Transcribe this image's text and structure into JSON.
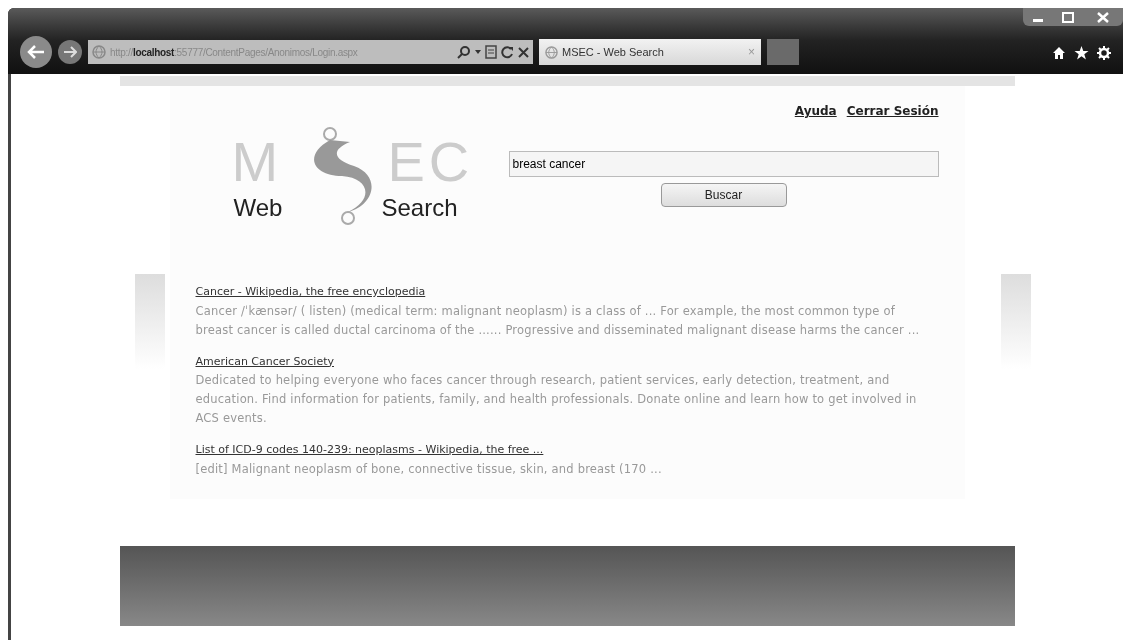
{
  "browser": {
    "address": "http://**localhost**:55777/ContentPages/Anonimos/Login.aspx",
    "tab_title": "MSEC - Web Search",
    "tab_close": "×",
    "window_buttons": [
      {
        "kind": "minimize"
      },
      {
        "kind": "maximize"
      },
      {
        "kind": "close"
      }
    ]
  },
  "header_links": [
    {
      "label": "Ayuda"
    },
    {
      "label": "Cerrar Sesión"
    }
  ],
  "logo": {
    "letters_left": "M",
    "letters_right": "EC",
    "word_left": "Web",
    "word_right": "Search"
  },
  "search": {
    "value": "breast cancer",
    "button": "Buscar"
  },
  "results": [
    {
      "title": "Cancer - Wikipedia, the free encyclopedia",
      "snippet": "Cancer /ˈkænsər/ ( listen) (medical term: malignant neoplasm) is a class of ... For example, the most common type of breast cancer is called ductal carcinoma of the ...... Progressive and disseminated malignant disease harms the cancer ..."
    },
    {
      "title": "American Cancer Society",
      "snippet": "Dedicated to helping everyone who faces cancer through research, patient services, early detection, treatment, and education. Find information for patients, family, and health professionals. Donate online and learn how to get involved in ACS events."
    },
    {
      "title": "List of ICD-9 codes 140-239: neoplasms - Wikipedia, the free ...",
      "snippet": "[edit] Malignant neoplasm of bone, connective tissue, skin, and breast (170 ..."
    }
  ]
}
